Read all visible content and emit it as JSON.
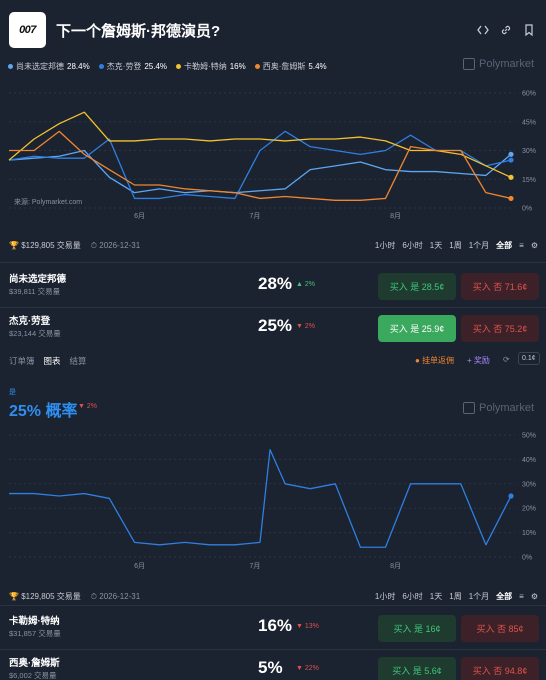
{
  "header": {
    "logo_text": "007",
    "title": "下一个詹姆斯·邦德演员?",
    "icons": [
      "code-icon",
      "link-icon",
      "bookmark-icon"
    ]
  },
  "legend": [
    {
      "name": "尚未选定邦德",
      "pct": "28.4%",
      "color": "#5ea7f0"
    },
    {
      "name": "杰克·劳登",
      "pct": "25.4%",
      "color": "#2f7fe0"
    },
    {
      "name": "卡勒姆·特纳",
      "pct": "16%",
      "color": "#f2c230"
    },
    {
      "name": "西奥·詹姆斯",
      "pct": "5.4%",
      "color": "#f0862f"
    }
  ],
  "watermark": "Polymarket",
  "source": "来源: Polymarket.com",
  "chart1": {
    "y_ticks": [
      "60%",
      "45%",
      "30%",
      "15%",
      "0%"
    ],
    "x_ticks": [
      "6月",
      "7月",
      "8月"
    ]
  },
  "stats": {
    "volume": "$129,805 交易量",
    "end_date": "2026-12-31"
  },
  "time_tabs": [
    "1小时",
    "6小时",
    "1天",
    "1周",
    "1个月",
    "全部"
  ],
  "time_tabs_active": "全部",
  "rows1": [
    {
      "name": "尚未选定邦德",
      "vol": "$39,811 交易量",
      "pct": "28%",
      "chg": "▲ 2%",
      "dir": "up",
      "yes": "买入 是 28.5¢",
      "no": "买入 否 71.6¢"
    },
    {
      "name": "杰克·劳登",
      "vol": "$23,144 交易量",
      "pct": "25%",
      "chg": "▼ 2%",
      "dir": "down",
      "yes": "买入 是 25.9¢",
      "no": "买入 否 75.2¢"
    }
  ],
  "subtabs": [
    "订单簿",
    "图表",
    "结算"
  ],
  "subtabs_active": "图表",
  "limit_order": "挂单返佣",
  "reward": "+ 奖励",
  "spread": "0.1¢",
  "detail": {
    "label": "是",
    "prob": "25% 概率",
    "chg": "▼ 2%"
  },
  "chart2": {
    "y_ticks": [
      "50%",
      "40%",
      "30%",
      "20%",
      "10%",
      "0%"
    ],
    "x_ticks": [
      "6月",
      "7月",
      "8月"
    ]
  },
  "rows2": [
    {
      "name": "卡勒姆·特纳",
      "vol": "$31,857 交易量",
      "pct": "16%",
      "chg": "▼ 13%",
      "dir": "down",
      "yes": "买入 是 16¢",
      "no": "买入 否 85¢"
    },
    {
      "name": "西奥·詹姆斯",
      "vol": "$6,002 交易量",
      "pct": "5%",
      "chg": "▼ 22%",
      "dir": "down",
      "yes": "买入 是 5.6¢",
      "no": "买入 否 94.8¢"
    }
  ],
  "chart_data": [
    {
      "type": "line",
      "ylim": [
        0,
        60
      ],
      "x": [
        0,
        5,
        10,
        15,
        20,
        25,
        30,
        35,
        40,
        45,
        50,
        55,
        60,
        65,
        70,
        75,
        80,
        85,
        90,
        95,
        100
      ],
      "series": [
        {
          "name": "尚未选定邦德",
          "color": "#5ea7f0",
          "values": [
            25,
            26,
            27,
            30,
            16,
            8,
            10,
            8,
            9,
            8,
            9,
            10,
            20,
            22,
            24,
            20,
            19,
            19,
            18,
            17,
            28
          ]
        },
        {
          "name": "杰克·劳登",
          "color": "#2f7fe0",
          "values": [
            25,
            27,
            26,
            26,
            36,
            5,
            5,
            7,
            6,
            5,
            30,
            40,
            32,
            30,
            28,
            30,
            38,
            30,
            30,
            22,
            25
          ]
        },
        {
          "name": "卡勒姆·特纳",
          "color": "#f2c230",
          "values": [
            25,
            36,
            44,
            50,
            35,
            35,
            36,
            36,
            35,
            36,
            36,
            35,
            36,
            36,
            37,
            35,
            30,
            30,
            28,
            22,
            16
          ]
        },
        {
          "name": "西奥·詹姆斯",
          "color": "#f0862f",
          "values": [
            30,
            30,
            40,
            28,
            20,
            12,
            12,
            10,
            9,
            8,
            5,
            6,
            5,
            4,
            4,
            5,
            32,
            30,
            30,
            8,
            5
          ]
        }
      ]
    },
    {
      "type": "line",
      "ylim": [
        0,
        50
      ],
      "x": [
        0,
        5,
        10,
        15,
        20,
        25,
        30,
        35,
        40,
        45,
        50,
        52,
        55,
        60,
        65,
        70,
        75,
        80,
        85,
        90,
        95,
        100
      ],
      "series": [
        {
          "name": "杰克·劳登",
          "color": "#2f7fe0",
          "values": [
            26,
            26,
            25,
            26,
            24,
            6,
            5,
            6,
            5,
            5,
            6,
            44,
            30,
            28,
            30,
            4,
            4,
            30,
            30,
            30,
            5,
            25
          ]
        }
      ]
    }
  ]
}
